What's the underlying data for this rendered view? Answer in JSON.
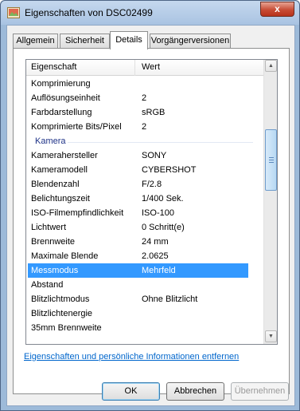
{
  "window": {
    "title": "Eigenschaften von DSC02499",
    "close_label": "x"
  },
  "tabs": [
    {
      "label": "Allgemein"
    },
    {
      "label": "Sicherheit"
    },
    {
      "label": "Details",
      "active": true
    },
    {
      "label": "Vorgängerversionen"
    }
  ],
  "list": {
    "columns": {
      "property": "Eigenschaft",
      "value": "Wert"
    },
    "rows_top": [
      {
        "name": "Komprimierung",
        "value": ""
      },
      {
        "name": "Auflösungseinheit",
        "value": "2"
      },
      {
        "name": "Farbdarstellung",
        "value": "sRGB"
      },
      {
        "name": "Komprimierte Bits/Pixel",
        "value": "2"
      }
    ],
    "group_label": "Kamera",
    "rows_camera": [
      {
        "name": "Kamerahersteller",
        "value": "SONY"
      },
      {
        "name": "Kameramodell",
        "value": "CYBERSHOT"
      },
      {
        "name": "Blendenzahl",
        "value": "F/2.8"
      },
      {
        "name": "Belichtungszeit",
        "value": "1/400 Sek."
      },
      {
        "name": "ISO-Filmempfindlichkeit",
        "value": "ISO-100"
      },
      {
        "name": "Lichtwert",
        "value": "0 Schritt(e)"
      },
      {
        "name": "Brennweite",
        "value": "24 mm"
      },
      {
        "name": "Maximale Blende",
        "value": "2.0625"
      },
      {
        "name": "Messmodus",
        "value": "Mehrfeld",
        "selected": true
      },
      {
        "name": "Abstand",
        "value": ""
      },
      {
        "name": "Blitzlichtmodus",
        "value": "Ohne Blitzlicht"
      },
      {
        "name": "Blitzlichtenergie",
        "value": ""
      },
      {
        "name": "35mm Brennweite",
        "value": ""
      }
    ]
  },
  "remove_link": "Eigenschaften und persönliche Informationen entfernen",
  "buttons": {
    "ok": "OK",
    "cancel": "Abbrechen",
    "apply": "Übernehmen"
  },
  "colors": {
    "selection": "#3399ff",
    "group_label": "#1e3287",
    "link": "#0066cc"
  }
}
